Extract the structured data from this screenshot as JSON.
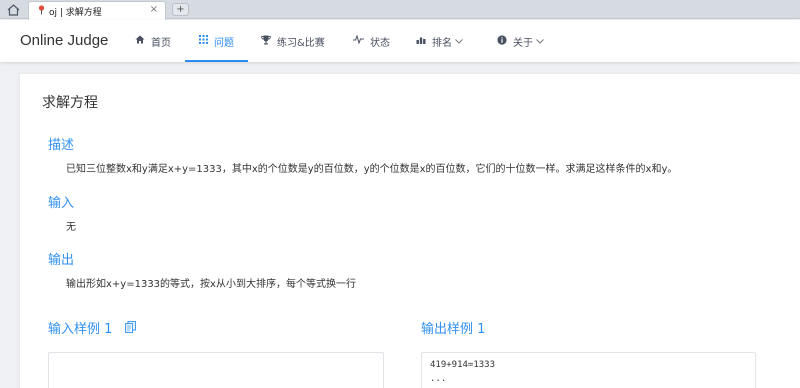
{
  "browser": {
    "tab_title": "oj | 求解方程",
    "close_glyph": "×",
    "new_tab_glyph": "+"
  },
  "navbar": {
    "logo": "Online Judge",
    "items": [
      {
        "label": "首页",
        "icon": "home-icon",
        "active": false
      },
      {
        "label": "问题",
        "icon": "grid-icon",
        "active": true
      },
      {
        "label": "练习&比赛",
        "icon": "trophy-icon",
        "active": false
      },
      {
        "label": "状态",
        "icon": "pulse-icon",
        "active": false
      },
      {
        "label": "排名",
        "icon": "bar-chart-icon",
        "active": false,
        "dropdown": true
      },
      {
        "label": "关于",
        "icon": "info-icon",
        "active": false,
        "dropdown": true
      }
    ],
    "active_color": "#2d8cf0"
  },
  "problem": {
    "title": "求解方程",
    "description_heading": "描述",
    "description": "已知三位整数x和y满足x+y=1333，其中x的个位数是y的百位数，y的个位数是x的百位数，它们的十位数一样。求满足这样条件的x和y。",
    "input_heading": "输入",
    "input": "无",
    "output_heading": "输出",
    "output": "输出形如x+y=1333的等式，按x从小到大排序，每个等式换一行",
    "sample_input_heading": "输入样例 1",
    "sample_output_heading": "输出样例 1",
    "sample_input": "",
    "sample_output": "419+914=1333\n..."
  }
}
